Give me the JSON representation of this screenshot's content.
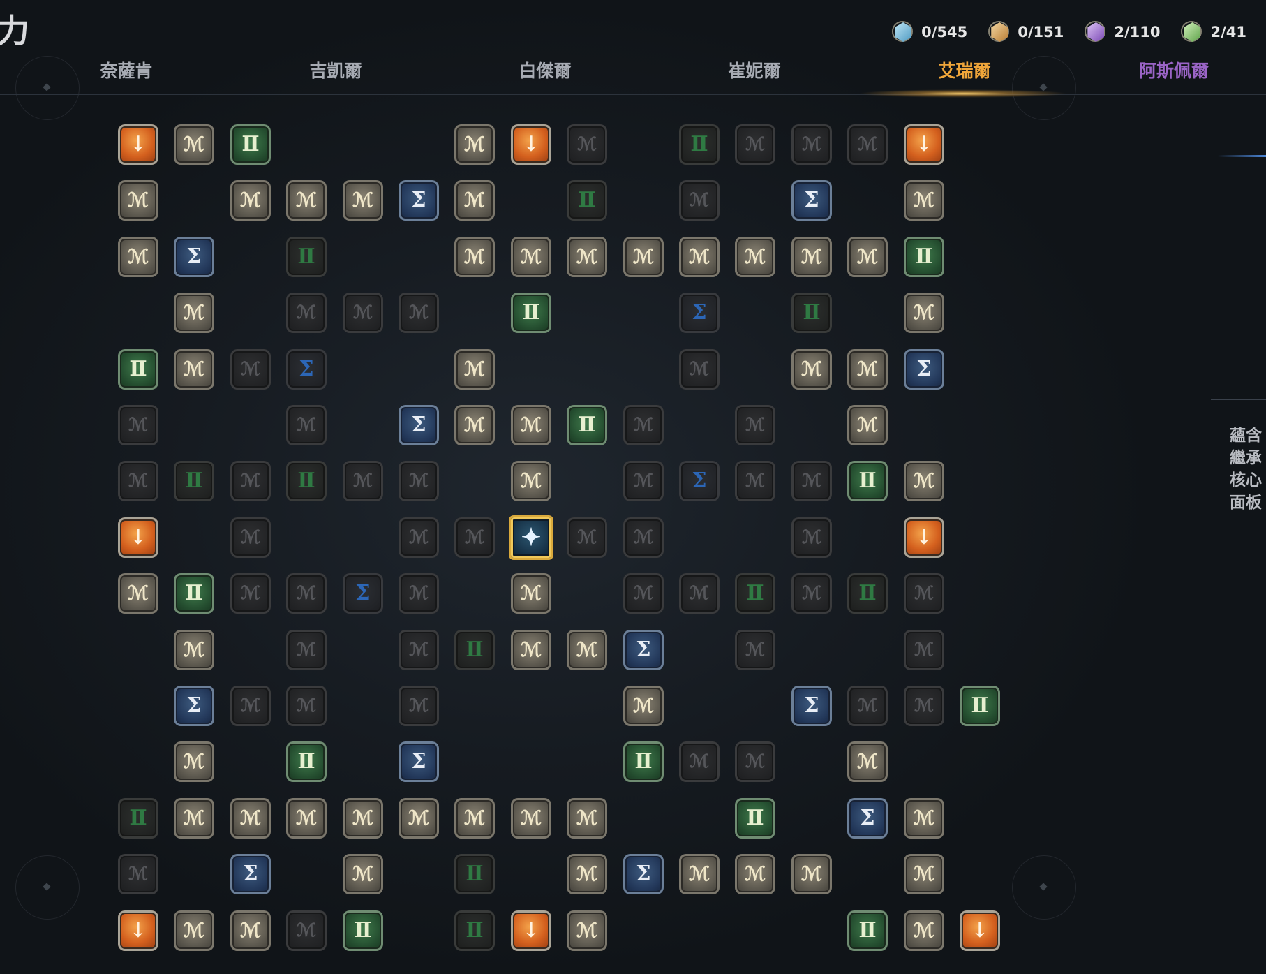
{
  "header": {
    "title": "力"
  },
  "currencies": [
    {
      "icon": "blue-gem-icon",
      "color": "#6fb3d6",
      "value": "0/545"
    },
    {
      "icon": "gold-gem-icon",
      "color": "#d9a85a",
      "value": "0/151"
    },
    {
      "icon": "purple-gem-icon",
      "color": "#9a6ad0",
      "value": "2/110"
    },
    {
      "icon": "green-gem-icon",
      "color": "#7fc46a",
      "value": "2/41"
    }
  ],
  "tabs": [
    {
      "label": "奈薩肯",
      "state": "normal"
    },
    {
      "label": "吉凱爾",
      "state": "normal"
    },
    {
      "label": "白傑爾",
      "state": "normal"
    },
    {
      "label": "崔妮爾",
      "state": "normal"
    },
    {
      "label": "艾瑞爾",
      "state": "active"
    },
    {
      "label": "阿斯佩爾",
      "state": "special"
    }
  ],
  "side_panel": {
    "text": "蘊含\n繼承\n核心\n面板"
  },
  "colors": {
    "accent": "#f0a63a",
    "special_tab": "#9a64c6",
    "start_border": "#d9a93c"
  },
  "legend": {
    "G": {
      "type": "gray-rune",
      "glyph": "ℳ"
    },
    "g": {
      "type": "green-rune",
      "glyph": "Ⅱ"
    },
    "B": {
      "type": "blue-rune",
      "glyph": "Σ"
    },
    "O": {
      "type": "orange-rune",
      "glyph": "↓"
    },
    "d": {
      "type": "locked-rune",
      "glyph": "ℳ"
    },
    "v": {
      "type": "locked-green-rune",
      "glyph": "Ⅱ"
    },
    "b": {
      "type": "locked-blue-rune",
      "glyph": "Σ"
    },
    "S": {
      "type": "start-node",
      "glyph": "✦"
    }
  },
  "board": [
    "OGg...GOd.vdddO",
    "G.GGGBG.v.d.B.G",
    "GB.v..GGGGGGGGg",
    ".G.ddd.g..b.v.G.",
    "gGdb..G...d.GGB",
    "d..d.BGGgd.d.G.",
    "dvdvdd.G.dbddgG",
    "O.d..ddSdd..d.O",
    "Ggddbd.G.ddvdvd",
    ".G.d.dvGGB.d..d",
    ".Bdd.d...G..Bddg",
    ".G.g.B...gdd.G.",
    "vGGGGGGGG..g.BG",
    "d.B.G.v.GBGGG.G",
    "OGGdg.vOG....gGO"
  ]
}
